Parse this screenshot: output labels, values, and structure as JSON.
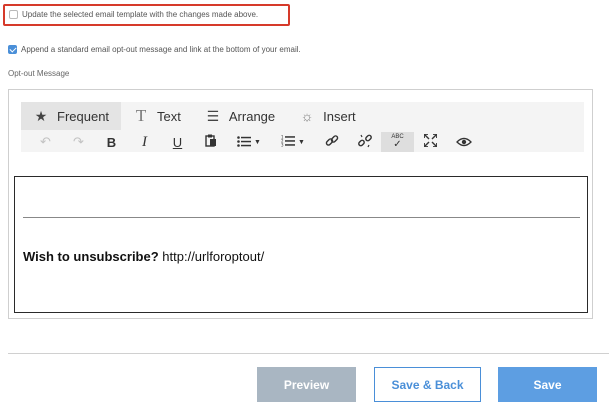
{
  "template_update": {
    "label": "Update the selected email template with the changes made above.",
    "checked": false
  },
  "optout_append": {
    "label": "Append a standard email opt-out message and link at the bottom of your email.",
    "checked": true
  },
  "optout_message_label": "Opt-out Message",
  "editor": {
    "tabs": [
      {
        "label": "Frequent",
        "icon": "star-icon",
        "active": true
      },
      {
        "label": "Text",
        "icon": "text-icon",
        "active": false
      },
      {
        "label": "Arrange",
        "icon": "align-icon",
        "active": false
      },
      {
        "label": "Insert",
        "icon": "lightbulb-icon",
        "active": false
      }
    ],
    "tools": [
      {
        "name": "undo-icon",
        "glyph": "↶"
      },
      {
        "name": "redo-icon",
        "glyph": "↷"
      },
      {
        "name": "bold-icon",
        "glyph": "B"
      },
      {
        "name": "italic-icon",
        "glyph": "I"
      },
      {
        "name": "underline-icon",
        "glyph": "U"
      },
      {
        "name": "paste-icon",
        "glyph": "📋"
      },
      {
        "name": "bullet-list-icon",
        "glyph": "☰"
      },
      {
        "name": "numbered-list-icon",
        "glyph": "☷"
      },
      {
        "name": "link-icon",
        "glyph": "🔗"
      },
      {
        "name": "unlink-icon",
        "glyph": "⛓"
      },
      {
        "name": "spellcheck-icon",
        "glyph": "ABC"
      },
      {
        "name": "fullscreen-icon",
        "glyph": "⤢"
      },
      {
        "name": "preview-eye-icon",
        "glyph": "👁"
      }
    ],
    "content": {
      "bold_text": "Wish to unsubscribe?",
      "link_text": " http://urlforoptout/"
    }
  },
  "buttons": {
    "preview": "Preview",
    "save_back": "Save & Back",
    "save": "Save"
  },
  "colors": {
    "highlight": "#d63a2a",
    "accent": "#4a8fd8",
    "preview_bg": "#a9b6c2",
    "save_bg": "#5d9ee2"
  }
}
